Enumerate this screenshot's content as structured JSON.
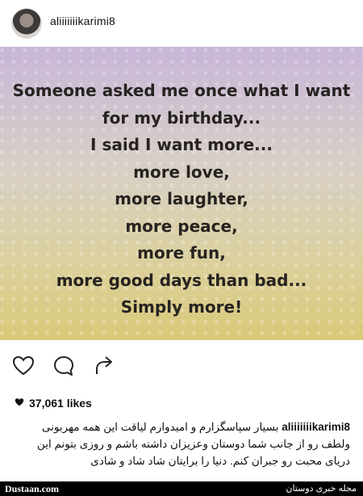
{
  "header": {
    "username": "aliiiiiiikarimi8"
  },
  "post": {
    "quote_lines": [
      "Someone asked me once what I want",
      "for my birthday...",
      "I said I want more...",
      "more love,",
      "more laughter,",
      "more peace,",
      "more fun,",
      "more good days than bad...",
      "Simply more!"
    ]
  },
  "actions": {
    "icons": [
      "heart-icon",
      "comment-icon",
      "share-icon"
    ]
  },
  "likes": {
    "count": "37,061 likes"
  },
  "caption": {
    "username": "aliiiiiiikarimi8",
    "text": "بسیار سپاسگزارم و امیدوارم لیاقت این همه مهربونی ولطف رو از جانب شما دوستان وعزیزان داشته باشم و روزی بتونم این دریای محبت رو جبران کنم. دنیا را برایتان شاد شاد و شادی"
  },
  "footer": {
    "left_text": "Dustaan.com",
    "right_text": "مجله خبری دوستان"
  }
}
